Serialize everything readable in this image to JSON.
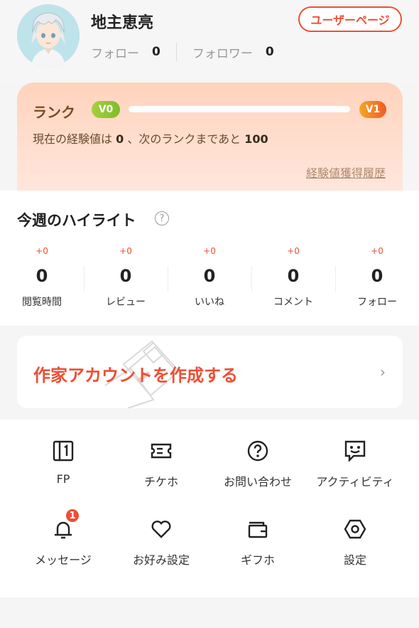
{
  "profile": {
    "username": "地主恵亮",
    "user_page_label": "ユーザーページ",
    "follow_label": "フォロー",
    "follow_count": "0",
    "follower_label": "フォロワー",
    "follower_count": "0"
  },
  "rank": {
    "title": "ランク",
    "current_badge": "V0",
    "next_badge": "V1",
    "progress_fraction": 0,
    "desc_prefix": "現在の経験値は ",
    "exp_value": "0",
    "desc_middle": " 、次のランクまであと ",
    "exp_remaining": "100",
    "history_link": "経験値獲得履歴"
  },
  "highlight": {
    "title": "今週のハイライト",
    "help_icon": "?",
    "stats": [
      {
        "delta": "+0",
        "value": "0",
        "label": "閲覧時間"
      },
      {
        "delta": "+0",
        "value": "0",
        "label": "レビュー"
      },
      {
        "delta": "+0",
        "value": "0",
        "label": "いいね"
      },
      {
        "delta": "+0",
        "value": "0",
        "label": "コメント"
      },
      {
        "delta": "+0",
        "value": "0",
        "label": "フォロー"
      }
    ]
  },
  "author": {
    "label": "作家アカウントを作成する",
    "chevron": "›"
  },
  "menu": {
    "items": [
      {
        "label": "FP",
        "icon": "fp-card-icon"
      },
      {
        "label": "チケホ",
        "icon": "ticket-icon"
      },
      {
        "label": "お問い合わせ",
        "icon": "help-circle-icon"
      },
      {
        "label": "アクティビティ",
        "icon": "smile-chat-icon"
      },
      {
        "label": "メッセージ",
        "icon": "bell-icon",
        "badge": "1"
      },
      {
        "label": "お好み設定",
        "icon": "heart-icon"
      },
      {
        "label": "ギフホ",
        "icon": "wallet-icon"
      },
      {
        "label": "設定",
        "icon": "hexagon-settings-icon"
      }
    ]
  },
  "colors": {
    "accent": "#ef4e33",
    "rank_text": "#7a4a24",
    "background": "#f5f5f5"
  }
}
